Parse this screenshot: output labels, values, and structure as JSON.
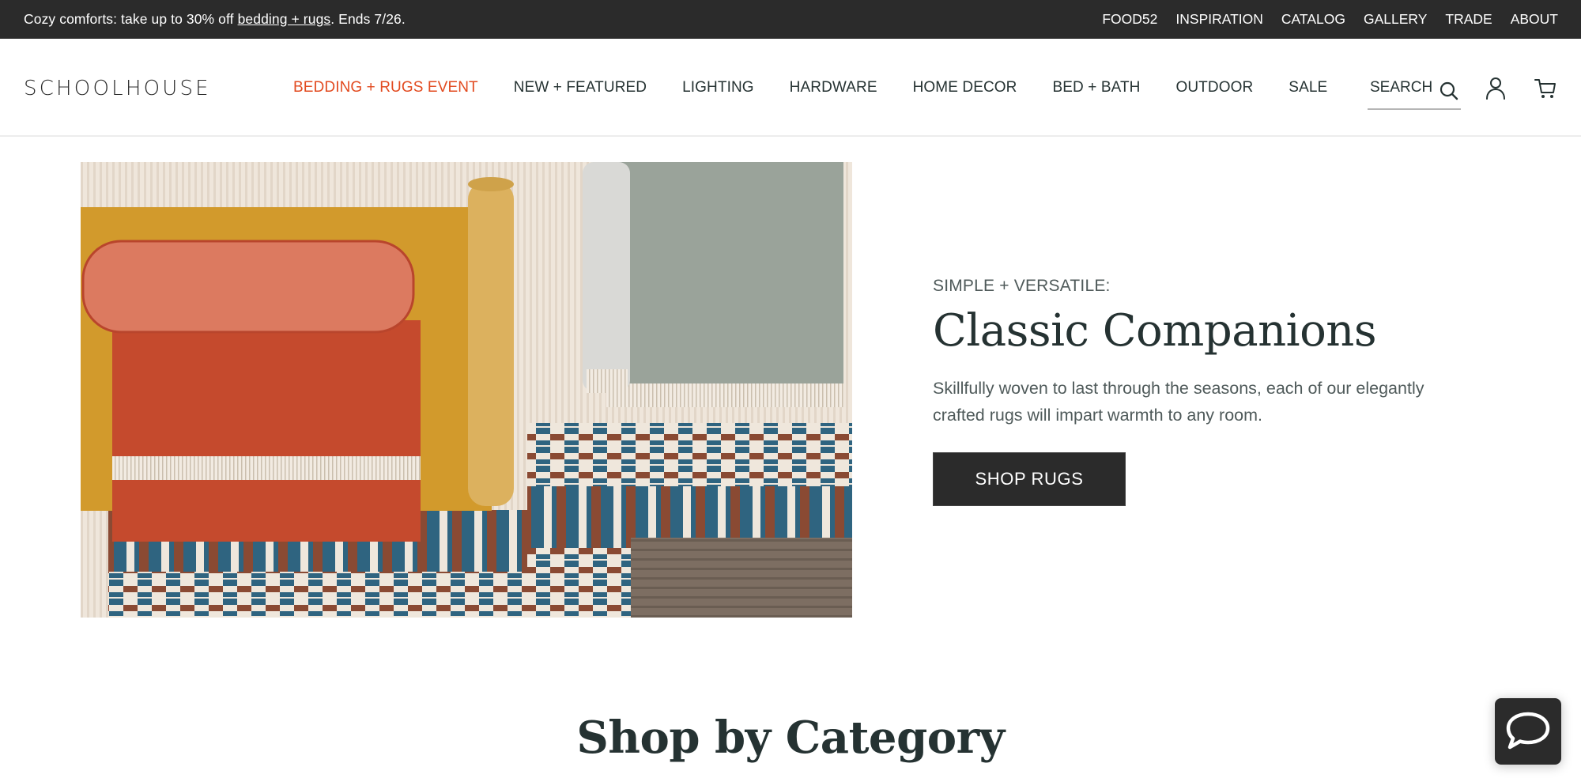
{
  "promo": {
    "prefix": "Cozy comforts: take up to 30% off ",
    "link": "bedding + rugs",
    "suffix": ". Ends 7/26."
  },
  "utility_nav": [
    "FOOD52",
    "INSPIRATION",
    "CATALOG",
    "GALLERY",
    "TRADE",
    "ABOUT"
  ],
  "header": {
    "logo": "SCHOOLHOUSE",
    "nav": [
      {
        "label": "BEDDING + RUGS EVENT",
        "highlight": true
      },
      {
        "label": "NEW + FEATURED"
      },
      {
        "label": "LIGHTING"
      },
      {
        "label": "HARDWARE"
      },
      {
        "label": "HOME DECOR"
      },
      {
        "label": "BED + BATH"
      },
      {
        "label": "OUTDOOR"
      },
      {
        "label": "SALE"
      }
    ],
    "search_label": "SEARCH",
    "icons": [
      "search-icon",
      "account-icon",
      "cart-icon"
    ]
  },
  "hero": {
    "image_alt": "Assorted rugs: rolled coral rug, mustard rug, sage green rug, blue and brown striped woven rugs",
    "eyebrow": "SIMPLE + VERSATILE:",
    "title": "Classic Companions",
    "description": "Skillfully woven to last through the seasons, each of our elegantly crafted rugs will impart warmth to any room.",
    "cta": "SHOP RUGS"
  },
  "section": {
    "title": "Shop by Category"
  },
  "chat": {
    "icon": "chat-bubble-icon"
  },
  "colors": {
    "accent": "#e24a1f",
    "dark": "#2b2b2b",
    "text": "#253232"
  }
}
